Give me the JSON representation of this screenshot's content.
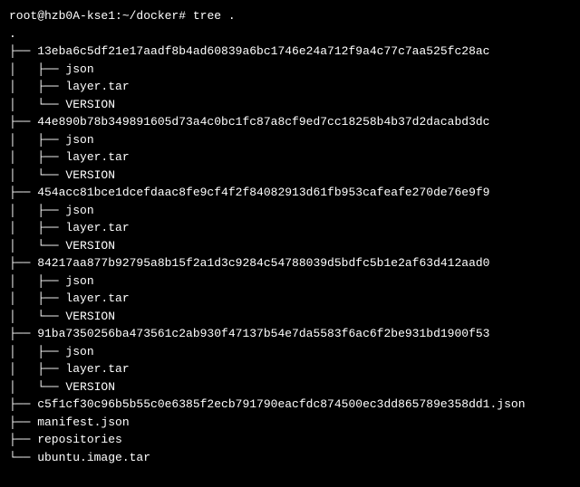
{
  "prompt": "root@hzb0A-kse1:~/docker# ",
  "command": "tree .",
  "lines": [
    ".",
    "├── 13eba6c5df21e17aadf8b4ad60839a6bc1746e24a712f9a4c77c7aa525fc28ac",
    "│   ├── json",
    "│   ├── layer.tar",
    "│   └── VERSION",
    "├── 44e890b78b349891605d73a4c0bc1fc87a8cf9ed7cc18258b4b37d2dacabd3dc",
    "│   ├── json",
    "│   ├── layer.tar",
    "│   └── VERSION",
    "├── 454acc81bce1dcefdaac8fe9cf4f2f84082913d61fb953cafeafe270de76e9f9",
    "│   ├── json",
    "│   ├── layer.tar",
    "│   └── VERSION",
    "├── 84217aa877b92795a8b15f2a1d3c9284c54788039d5bdfc5b1e2af63d412aad0",
    "│   ├── json",
    "│   ├── layer.tar",
    "│   └── VERSION",
    "├── 91ba7350256ba473561c2ab930f47137b54e7da5583f6ac6f2be931bd1900f53",
    "│   ├── json",
    "│   ├── layer.tar",
    "│   └── VERSION",
    "├── c5f1cf30c96b5b55c0e6385f2ecb791790eacfdc874500ec3dd865789e358dd1.json",
    "├── manifest.json",
    "├── repositories",
    "└── ubuntu.image.tar"
  ]
}
